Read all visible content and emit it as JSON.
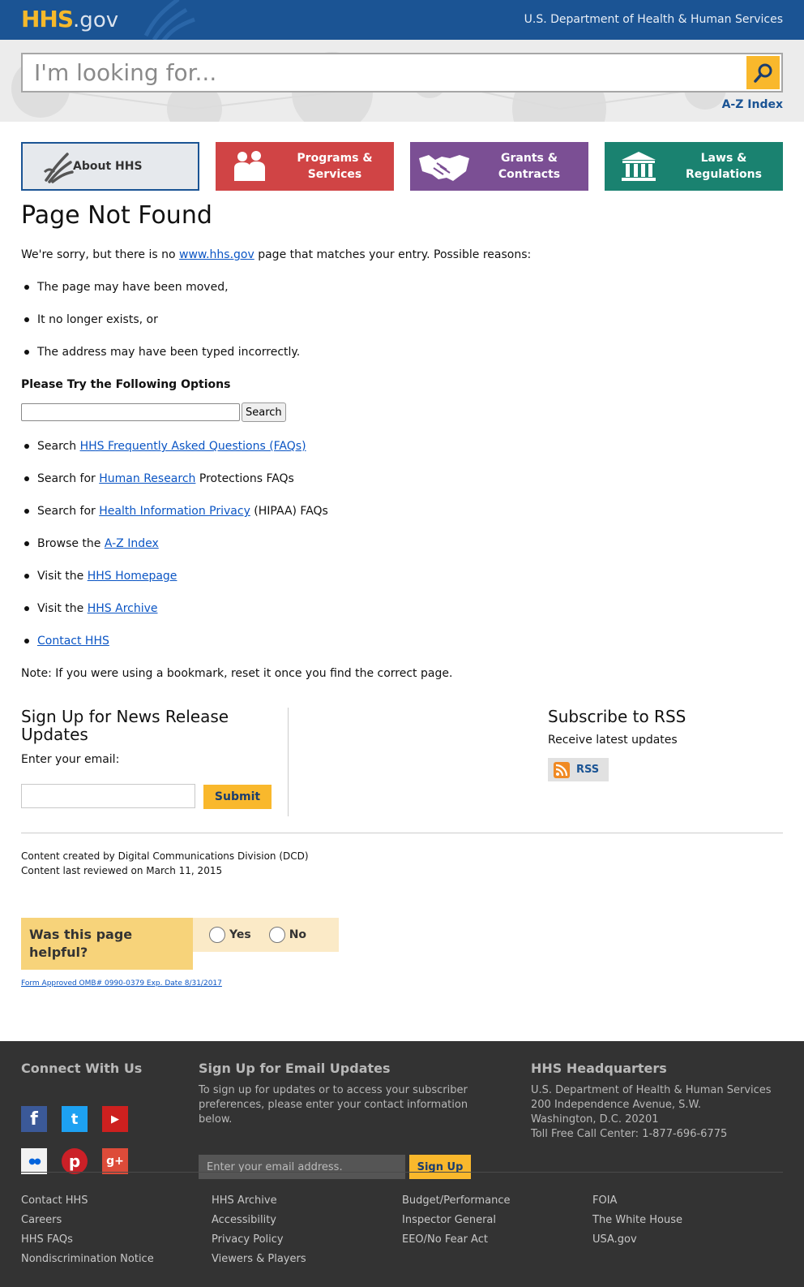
{
  "header": {
    "logo_hhs": "HHS",
    "logo_gov": ".gov",
    "department": "U.S. Department of Health & Human Services"
  },
  "search": {
    "placeholder": "I'm looking for...",
    "az_index": "A-Z Index"
  },
  "nav_tiles": [
    {
      "label": "About HHS",
      "icon": "hhs-eagle-icon",
      "color": "#e6e9ed"
    },
    {
      "label": "Programs & Services",
      "icon": "people-icon",
      "color": "#d04445"
    },
    {
      "label": "Grants & Contracts",
      "icon": "handshake-icon",
      "color": "#7b4f94"
    },
    {
      "label": "Laws & Regulations",
      "icon": "courthouse-icon",
      "color": "#1a8270"
    }
  ],
  "main": {
    "title": "Page Not Found",
    "intro_before": "We're sorry, but there is no ",
    "intro_link": "www.hhs.gov",
    "intro_after": " page that matches your entry. Possible reasons:",
    "reasons": [
      "The page may have been moved,",
      "It no longer exists, or",
      "The address may have been typed incorrectly."
    ],
    "options_heading": "Please Try the Following Options",
    "search_button": "Search",
    "options": [
      {
        "before": "Search ",
        "link": "HHS Frequently Asked Questions (FAQs)",
        "after": ""
      },
      {
        "before": "Search for ",
        "link": "Human Research",
        "after": " Protections FAQs"
      },
      {
        "before": "Search for ",
        "link": "Health Information Privacy",
        "after": " (HIPAA) FAQs"
      },
      {
        "before": "Browse the ",
        "link": "A-Z Index",
        "after": ""
      },
      {
        "before": "Visit the ",
        "link": "HHS Homepage",
        "after": ""
      },
      {
        "before": "Visit the ",
        "link": "HHS Archive",
        "after": ""
      },
      {
        "before": "",
        "link": "Contact HHS",
        "after": ""
      }
    ],
    "note": "Note: If you were using a bookmark, reset it once you find the correct page."
  },
  "signup": {
    "heading": "Sign Up for News Release Updates",
    "email_label": "Enter your email:",
    "submit": "Submit"
  },
  "rss": {
    "heading": "Subscribe to RSS",
    "subtext": "Receive latest updates",
    "button": "RSS"
  },
  "credits": {
    "created": "Content created by Digital Communications Division (DCD)",
    "reviewed": "Content last reviewed on March 11, 2015"
  },
  "feedback": {
    "question": "Was this page helpful?",
    "yes": "Yes",
    "no": "No",
    "omb": "Form Approved OMB# 0990-0379 Exp. Date 8/31/2017"
  },
  "footer": {
    "connect_heading": "Connect With Us",
    "social": [
      {
        "name": "facebook",
        "glyph": "f",
        "color": "#3b5998"
      },
      {
        "name": "twitter",
        "glyph": "t",
        "color": "#1da1f2"
      },
      {
        "name": "youtube",
        "glyph": "▶",
        "color": "#cd201f"
      },
      {
        "name": "flickr",
        "glyph": "●●",
        "color": "#f2f2f2"
      },
      {
        "name": "pinterest",
        "glyph": "p",
        "color": "#cb2027"
      },
      {
        "name": "googleplus",
        "glyph": "g+",
        "color": "#dd4b39"
      }
    ],
    "email_heading": "Sign Up for Email Updates",
    "email_text": "To sign up for updates or to access your subscriber preferences, please enter your contact information below.",
    "email_placeholder": "Enter your email address.",
    "email_button": "Sign Up",
    "hq_heading": "HHS Headquarters",
    "hq_lines": [
      "U.S. Department of Health & Human Services",
      "200 Independence Avenue, S.W.",
      "Washington, D.C. 20201",
      "Toll Free Call Center: 1-877-696-6775"
    ],
    "link_columns": [
      [
        "Contact HHS",
        "Careers",
        "HHS FAQs",
        "Nondiscrimination Notice"
      ],
      [
        "HHS Archive",
        "Accessibility",
        "Privacy Policy",
        "Viewers & Players"
      ],
      [
        "Budget/Performance",
        "Inspector General",
        "EEO/No Fear Act"
      ],
      [
        "FOIA",
        "The White House",
        "USA.gov"
      ]
    ]
  }
}
